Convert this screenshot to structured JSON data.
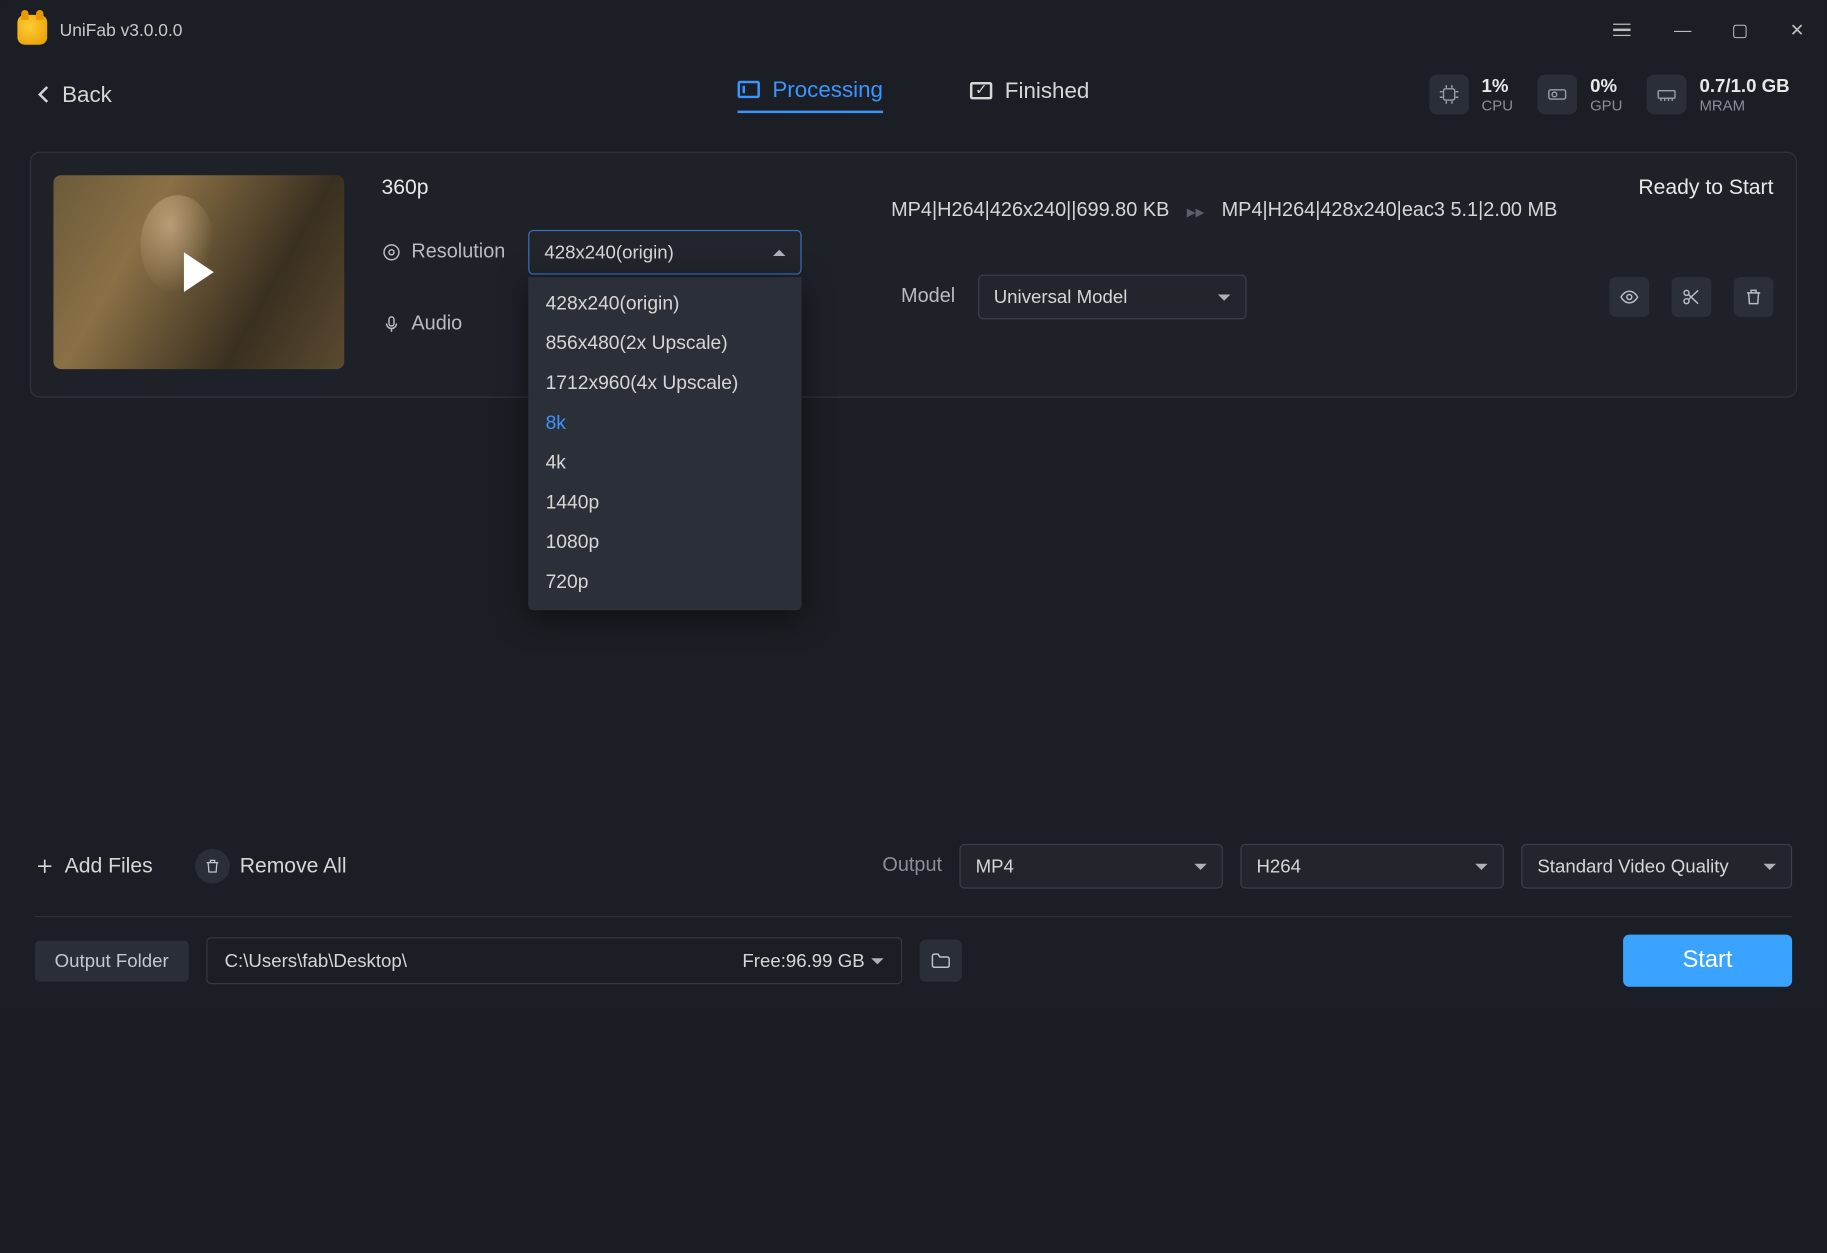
{
  "app": {
    "title": "UniFab v3.0.0.0"
  },
  "header": {
    "back": "Back",
    "tabs": {
      "processing": "Processing",
      "finished": "Finished"
    },
    "stats": {
      "cpu": {
        "value": "1%",
        "label": "CPU"
      },
      "gpu": {
        "value": "0%",
        "label": "GPU"
      },
      "ram": {
        "value": "0.7/1.0 GB",
        "label": "MRAM"
      }
    }
  },
  "task": {
    "title": "360p",
    "resolution_label": "Resolution",
    "resolution_value": "428x240(origin)",
    "audio_label": "Audio",
    "model_label": "Model",
    "model_value": "Universal Model",
    "source_fmt": "MP4|H264|426x240||699.80 KB",
    "target_fmt": "MP4|H264|428x240|eac3 5.1|2.00 MB",
    "status": "Ready to Start"
  },
  "resolution_options": [
    "428x240(origin)",
    "856x480(2x Upscale)",
    "1712x960(4x Upscale)",
    "8k",
    "4k",
    "1440p",
    "1080p",
    "720p"
  ],
  "res_highlight_index": 3,
  "bottom": {
    "add_files": "Add Files",
    "remove_all": "Remove All",
    "output_label": "Output",
    "output_format": "MP4",
    "encoder": "H264",
    "quality": "Standard Video Quality"
  },
  "footer": {
    "output_folder_btn": "Output Folder",
    "path": "C:\\Users\\fab\\Desktop\\",
    "free": "Free:96.99 GB",
    "start": "Start"
  }
}
